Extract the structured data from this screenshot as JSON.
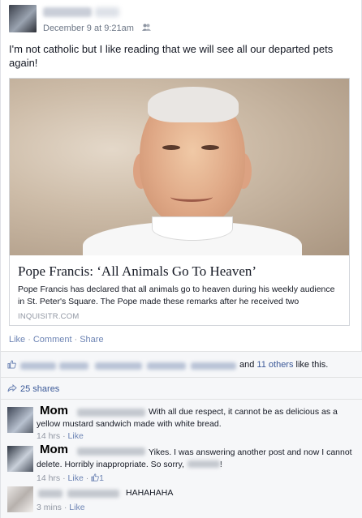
{
  "post": {
    "timestamp": "December 9 at 9:21am",
    "privacy_icon": "friends-icon",
    "status_text": "I'm not catholic but I like reading that we will see all our departed pets again!"
  },
  "link": {
    "title": "Pope Francis: ‘All Animals Go To Heaven’",
    "description": "Pope Francis has declared that all animals go to heaven during his weekly audience in St. Peter's Square. The Pope made these remarks after he received two",
    "domain": "INQUISITR.COM"
  },
  "actions": {
    "like": "Like",
    "comment": "Comment",
    "share": "Share"
  },
  "likes": {
    "and_text": "and",
    "others_link": "11 others",
    "tail": "like this."
  },
  "shares": {
    "label": "25 shares"
  },
  "comments": [
    {
      "name": "Mom",
      "text": "With all due respect, it cannot be as delicious as a yellow mustard sandwich made with white bread.",
      "time": "14 hrs",
      "like": "Like"
    },
    {
      "name": "Mom",
      "text": "Yikes. I was answering another post and now I cannot delete. Horribly inappropriate. So sorry,",
      "text_end": "!",
      "time": "14 hrs",
      "like": "Like",
      "like_count": "1"
    },
    {
      "text": "HAHAHAHA",
      "time": "3 mins",
      "like": "Like"
    }
  ]
}
